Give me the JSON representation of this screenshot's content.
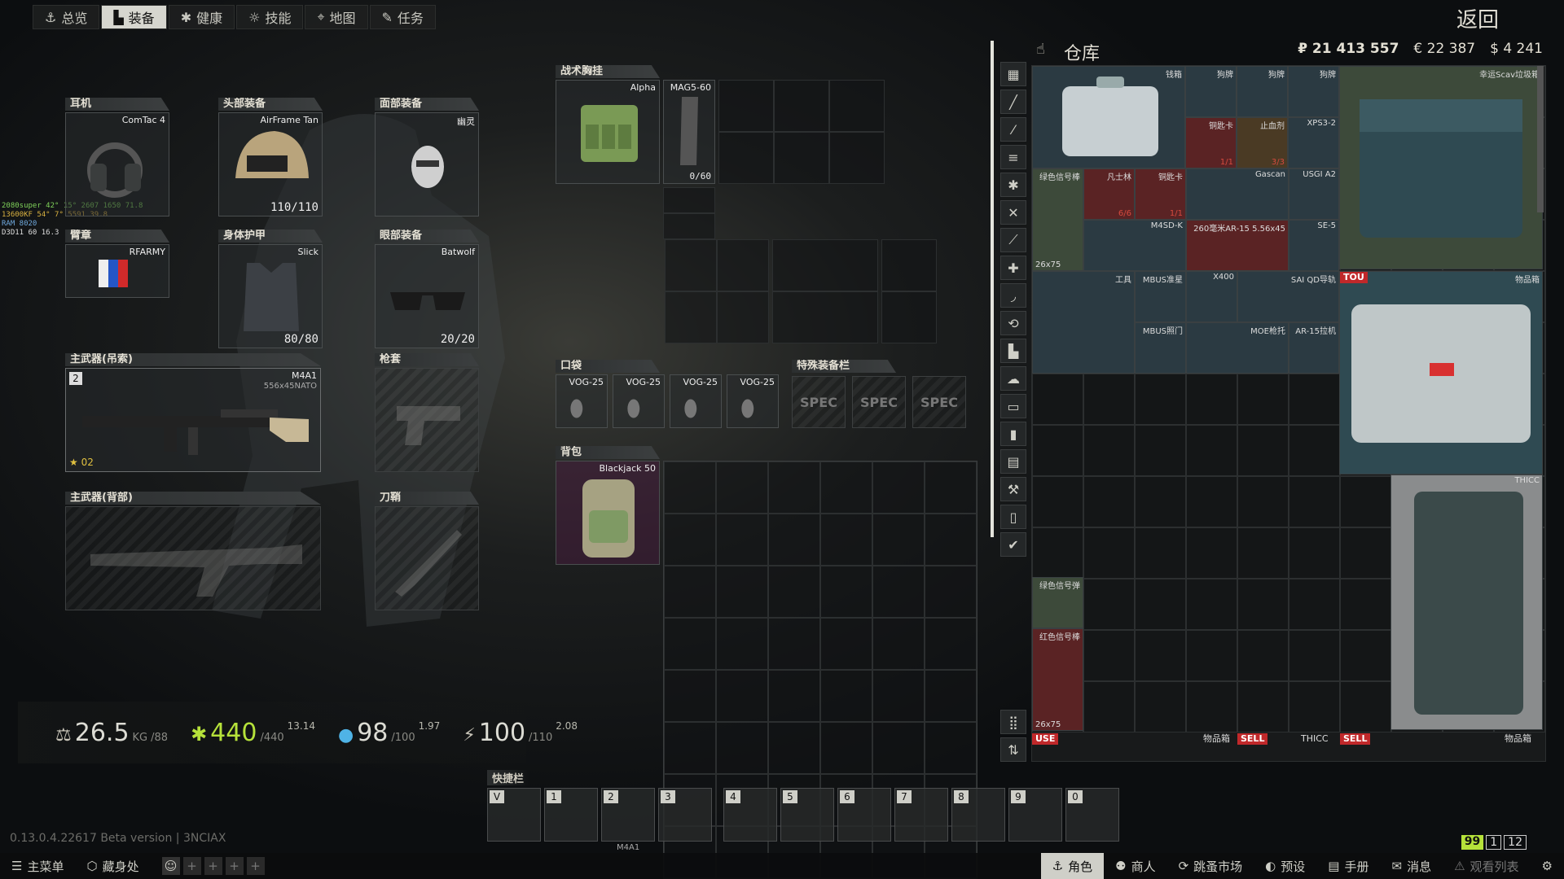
{
  "tabs": [
    {
      "label": "总览",
      "icon": "⚓"
    },
    {
      "label": "装备",
      "icon": "▙"
    },
    {
      "label": "健康",
      "icon": "✱"
    },
    {
      "label": "技能",
      "icon": "☼"
    },
    {
      "label": "地图",
      "icon": "⌖"
    },
    {
      "label": "任务",
      "icon": "✎"
    }
  ],
  "back_label": "返回",
  "slots": {
    "earpiece": {
      "title": "耳机",
      "item": "ComTac 4"
    },
    "headwear": {
      "title": "头部装备",
      "item": "AirFrame Tan",
      "durability": "110/110"
    },
    "facecover": {
      "title": "面部装备",
      "item": "幽灵"
    },
    "armband": {
      "title": "臂章",
      "item": "RFARMY"
    },
    "armor": {
      "title": "身体护甲",
      "item": "Slick",
      "durability": "80/80"
    },
    "eyewear": {
      "title": "眼部装备",
      "item": "Batwolf",
      "durability": "20/20"
    },
    "primary_sling": {
      "title": "主武器(吊索)",
      "item": "M4A1",
      "caliber": "556x45NATO",
      "slot_num": "2",
      "rank": "02"
    },
    "holster": {
      "title": "枪套"
    },
    "primary_back": {
      "title": "主武器(背部)"
    },
    "scabbard": {
      "title": "刀鞘"
    }
  },
  "rig": {
    "title": "战术胸挂",
    "item": "Alpha",
    "mag_name": "MAG5-60",
    "mag_count": "0/60"
  },
  "pockets": {
    "title": "口袋",
    "items": [
      "VOG-25",
      "VOG-25",
      "VOG-25",
      "VOG-25"
    ]
  },
  "special": {
    "title": "特殊装备栏",
    "items": [
      "SPEC",
      "SPEC",
      "SPEC"
    ]
  },
  "backpack": {
    "title": "背包",
    "item": "Blackjack 50"
  },
  "stats": {
    "weight": "26.5",
    "weight_unit": "KG",
    "weight_max": "/88",
    "health": "440",
    "health_max": "/440",
    "health_regen": "13.14",
    "hydration": "98",
    "hydration_max": "/100",
    "hydration_regen": "1.97",
    "energy": "100",
    "energy_max": "/110",
    "energy_regen": "2.08"
  },
  "hw_overlay": [
    "2080super 42° 15° 2607 1650 71.8",
    "13600KF 54° 7° 5591 39.8",
    "RAM 8020",
    "D3D11 60 16.3"
  ],
  "stash": {
    "title": "仓库",
    "rub": "₽ 21 413 557",
    "eur": "€ 22 387",
    "usd": "$ 4 241",
    "items": [
      {
        "name": "钱箱"
      },
      {
        "name": "狗牌"
      },
      {
        "name": "狗牌"
      },
      {
        "name": "狗牌"
      },
      {
        "name": "幸运Scav垃圾箱"
      },
      {
        "name": "铜匙卡",
        "count": "1/1"
      },
      {
        "name": "止血剂",
        "count": "3/3"
      },
      {
        "name": "XPS3-2"
      },
      {
        "name": "绿色信号棒"
      },
      {
        "name": "凡士林",
        "count": "6/6"
      },
      {
        "name": "铜匙卡",
        "count": "1/1"
      },
      {
        "name": "Gascan"
      },
      {
        "name": "USGI A2"
      },
      {
        "name": "M4SD-K"
      },
      {
        "name": "260毫米AR-15 5.56x45"
      },
      {
        "name": "SE-5"
      },
      {
        "name": "26x75"
      },
      {
        "name": "工具"
      },
      {
        "name": "MBUS准星"
      },
      {
        "name": "X400"
      },
      {
        "name": "SAI QD导轨"
      },
      {
        "name": "TOU"
      },
      {
        "name": "物品箱"
      },
      {
        "name": "MBUS照门"
      },
      {
        "name": "MOE枪托"
      },
      {
        "name": "AR-15拉机"
      },
      {
        "name": "THICC"
      },
      {
        "name": "绿色信号弹"
      },
      {
        "name": "红色信号棒"
      },
      {
        "name": "26x75"
      },
      {
        "name": "USE"
      },
      {
        "name": "物品箱"
      },
      {
        "name": "SELL"
      },
      {
        "name": "THICC"
      },
      {
        "name": "SELL"
      },
      {
        "name": "物品箱"
      }
    ]
  },
  "quickbar": {
    "title": "快捷栏",
    "keys": [
      "V",
      "1",
      "2",
      "3",
      "4",
      "5",
      "6",
      "7",
      "8",
      "9",
      "0"
    ],
    "under_label": "M4A1"
  },
  "version": "0.13.0.4.22617 Beta version | 3NCIAX",
  "status_badges": [
    "99",
    "1",
    "12"
  ],
  "bottom_left": [
    {
      "label": "主菜单",
      "icon": "☰"
    },
    {
      "label": "藏身处",
      "icon": "⬡"
    }
  ],
  "bottom_right": [
    {
      "label": "角色",
      "icon": "⚓"
    },
    {
      "label": "商人",
      "icon": "⚉"
    },
    {
      "label": "跳蚤市场",
      "icon": "⟳"
    },
    {
      "label": "预设",
      "icon": "◐"
    },
    {
      "label": "手册",
      "icon": "▤"
    },
    {
      "label": "消息",
      "icon": "✉"
    },
    {
      "label": "观看列表",
      "icon": "⚠"
    }
  ],
  "colors": {
    "accent_green": "#b6e23a",
    "sell_red": "#c0282a",
    "active_tab": "#d6d6cf"
  }
}
